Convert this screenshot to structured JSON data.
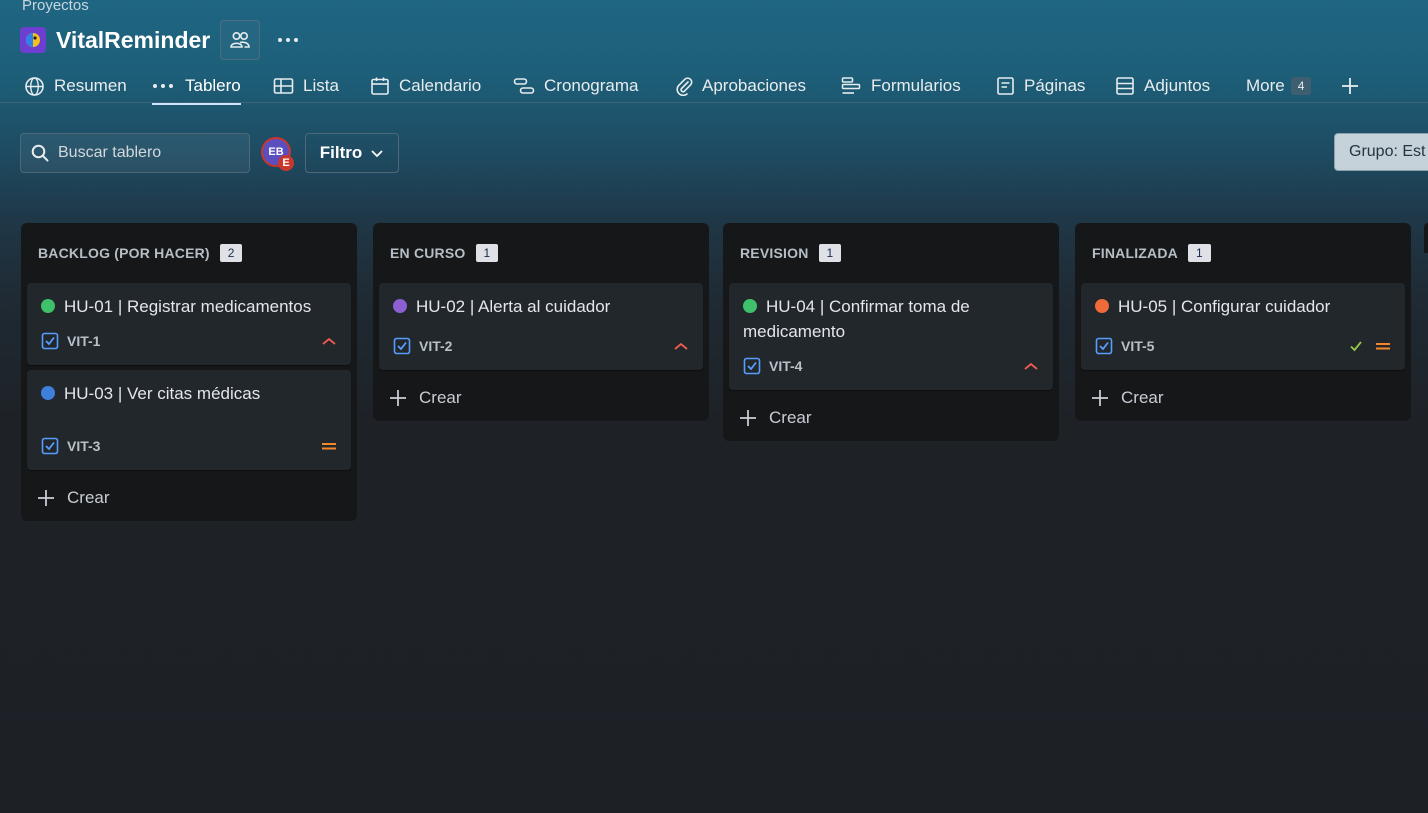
{
  "breadcrumb": "Proyectos",
  "app": {
    "title": "VitalReminder"
  },
  "tabs": [
    {
      "label": "Resumen",
      "icon": "globe-icon"
    },
    {
      "label": "Tablero",
      "icon": "board-dots-icon",
      "active": true
    },
    {
      "label": "Lista",
      "icon": "list-table-icon"
    },
    {
      "label": "Calendario",
      "icon": "calendar-icon"
    },
    {
      "label": "Cronograma",
      "icon": "timeline-icon"
    },
    {
      "label": "Aprobaciones",
      "icon": "paperclip-icon"
    },
    {
      "label": "Formularios",
      "icon": "forms-icon"
    },
    {
      "label": "Páginas",
      "icon": "page-icon"
    },
    {
      "label": "Adjuntos",
      "icon": "attachments-icon"
    },
    {
      "label": "More",
      "count": "4",
      "icon": "more-icon"
    }
  ],
  "toolbar": {
    "search_placeholder": "Buscar tablero",
    "avatar_initials": "EB",
    "avatar_badge": "E",
    "filter_label": "Filtro",
    "group_label": "Grupo: Est"
  },
  "columns": [
    {
      "name": "BACKLOG (POR HACER)",
      "count": "2",
      "cards": [
        {
          "title": "HU-01 | Registrar medicamentos",
          "key": "VIT-1",
          "dot_color": "#3fc06a",
          "priority": "high"
        },
        {
          "title": "HU-03 | Ver citas médicas",
          "key": "VIT-3",
          "dot_color": "#3f7fdc",
          "priority": "medium"
        }
      ],
      "create_label": "Crear"
    },
    {
      "name": "EN CURSO",
      "count": "1",
      "cards": [
        {
          "title": "HU-02 | Alerta al cuidador",
          "key": "VIT-2",
          "dot_color": "#8e5fd1",
          "priority": "high"
        }
      ],
      "create_label": "Crear"
    },
    {
      "name": "REVISION",
      "count": "1",
      "cards": [
        {
          "title": "HU-04 | Confirmar toma de medicamento",
          "key": "VIT-4",
          "dot_color": "#3fc06a",
          "priority": "high"
        }
      ],
      "create_label": "Crear"
    },
    {
      "name": "FINALIZADA",
      "count": "1",
      "cards": [
        {
          "title": "HU-05 | Configurar cuidador",
          "key": "VIT-5",
          "dot_color": "#f06a3a",
          "priority": "medium",
          "done": true
        }
      ],
      "create_label": "Crear"
    }
  ],
  "colors": {
    "priority_high": "#f15b50",
    "priority_medium": "#f5862b",
    "done_check": "#94c748",
    "checkbox": "#579dff"
  }
}
